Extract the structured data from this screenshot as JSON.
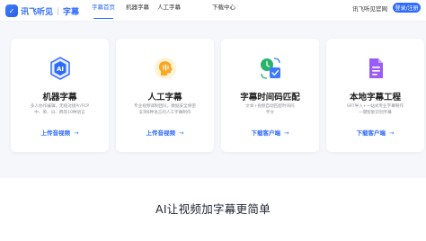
{
  "header": {
    "logo_text": "讯飞听见",
    "logo_sub": "字幕",
    "nav": [
      {
        "label": "字幕首页",
        "active": true
      },
      {
        "label": "机器字幕",
        "active": false
      },
      {
        "label": "人工字幕",
        "active": false
      },
      {
        "label": "下载中心",
        "active": false
      }
    ],
    "official_link": "讯飞听见官网",
    "login_button": "登录/注册"
  },
  "cards": [
    {
      "title": "机器字幕",
      "desc": "多人协作编辑，无缝对接Pr/FCP\n中、英、日、韩等10种语言",
      "cta": "上传音视频",
      "icon": "ai-chip-icon"
    },
    {
      "title": "人工字幕",
      "desc": "专业视频译制团队，数据安全保密\n支持8种语言的人工字幕制作",
      "cta": "上传音视频",
      "icon": "human-head-icon"
    },
    {
      "title": "字幕时间码匹配",
      "desc": "文本+视频自动匹配时间码\n字文",
      "cta": "下载客户端",
      "icon": "timecode-match-icon"
    },
    {
      "title": "本地字幕工程",
      "desc": "SRT导入+一站式专业字幕制作\n一键智能识别字幕",
      "cta": "下载客户端",
      "icon": "local-project-icon"
    }
  ],
  "cta_arrow": "→",
  "slogan": "AI让视频加字幕更简单",
  "colors": {
    "accent": "#2f6bff",
    "background": "#f5f7fb"
  }
}
